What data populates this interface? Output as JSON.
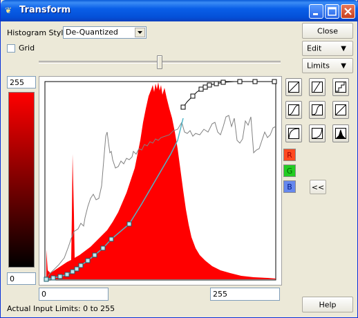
{
  "window": {
    "title": "Transform"
  },
  "controls": {
    "histogram_style_label": "Histogram Style:",
    "histogram_style_value": "De-Quantized",
    "grid_label": "Grid",
    "grid_checked": false,
    "slider_position": 0.5
  },
  "buttons": {
    "close": "Close",
    "edit": "Edit",
    "limits": "Limits",
    "collapse": "<<",
    "help": "Help"
  },
  "output_range": {
    "top": "255",
    "bottom": "0"
  },
  "input_range": {
    "min": "0",
    "max": "255"
  },
  "status_text": "Actual Input Limits: 0 to 255",
  "channels": [
    {
      "label": "R",
      "color": "#ff4a20",
      "text_color": "#a00000"
    },
    {
      "label": "G",
      "color": "#22cc22",
      "text_color": "#006600"
    },
    {
      "label": "B",
      "color": "#6688ee",
      "text_color": "#001a88"
    }
  ],
  "curve_presets": [
    "linear-icon",
    "steep-linear-icon",
    "step-icon",
    "s-curve-icon",
    "s-curve-steep-icon",
    "gamma-icon",
    "log-curve-icon",
    "exp-curve-icon",
    "histogram-equalize-icon"
  ],
  "colors": {
    "histogram_fill": "#ff0000",
    "curve_line": "#4fb6c8",
    "plateau_line": "#000000",
    "cdf_line": "#808080",
    "titlebar": "#0a5fe8"
  }
}
